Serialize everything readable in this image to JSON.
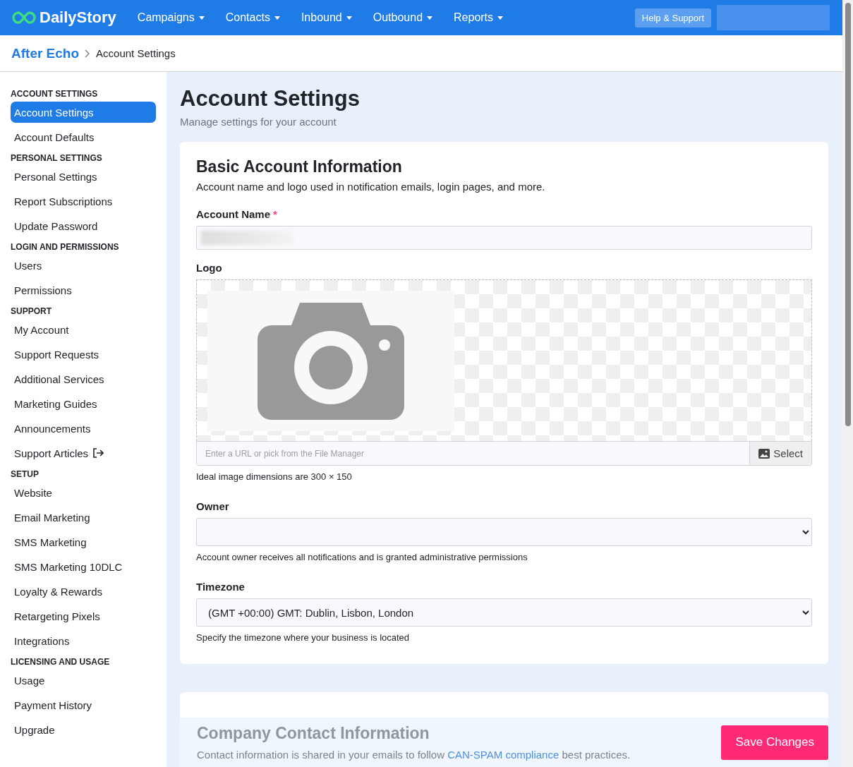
{
  "navbar": {
    "brand": "DailyStory",
    "menus": [
      {
        "label": "Campaigns"
      },
      {
        "label": "Contacts"
      },
      {
        "label": "Inbound"
      },
      {
        "label": "Outbound"
      },
      {
        "label": "Reports"
      }
    ],
    "help_button": "Help & Support"
  },
  "breadcrumb": {
    "items": [
      "After Echo",
      "Account Settings"
    ]
  },
  "sidebar": {
    "sections": [
      {
        "heading": "ACCOUNT SETTINGS",
        "items": [
          {
            "label": "Account Settings",
            "selected": true,
            "external": false
          },
          {
            "label": "Account Defaults",
            "selected": false,
            "external": false
          }
        ]
      },
      {
        "heading": "PERSONAL SETTINGS",
        "items": [
          {
            "label": "Personal Settings",
            "selected": false,
            "external": false
          },
          {
            "label": "Report Subscriptions",
            "selected": false,
            "external": false
          },
          {
            "label": "Update Password",
            "selected": false,
            "external": false
          }
        ]
      },
      {
        "heading": "LOGIN AND PERMISSIONS",
        "items": [
          {
            "label": "Users",
            "selected": false,
            "external": false
          },
          {
            "label": "Permissions",
            "selected": false,
            "external": false
          }
        ]
      },
      {
        "heading": "SUPPORT",
        "items": [
          {
            "label": "My Account",
            "selected": false,
            "external": false
          },
          {
            "label": "Support Requests",
            "selected": false,
            "external": false
          },
          {
            "label": "Additional Services",
            "selected": false,
            "external": false
          },
          {
            "label": "Marketing Guides",
            "selected": false,
            "external": false
          },
          {
            "label": "Announcements",
            "selected": false,
            "external": false
          },
          {
            "label": "Support Articles",
            "selected": false,
            "external": true
          }
        ]
      },
      {
        "heading": "SETUP",
        "items": [
          {
            "label": "Website",
            "selected": false,
            "external": false
          },
          {
            "label": "Email Marketing",
            "selected": false,
            "external": false
          },
          {
            "label": "SMS Marketing",
            "selected": false,
            "external": false
          },
          {
            "label": "SMS Marketing 10DLC",
            "selected": false,
            "external": false
          },
          {
            "label": "Loyalty & Rewards",
            "selected": false,
            "external": false
          },
          {
            "label": "Retargeting Pixels",
            "selected": false,
            "external": false
          },
          {
            "label": "Integrations",
            "selected": false,
            "external": false
          }
        ]
      },
      {
        "heading": "LICENSING AND USAGE",
        "items": [
          {
            "label": "Usage",
            "selected": false,
            "external": false
          },
          {
            "label": "Payment History",
            "selected": false,
            "external": false
          },
          {
            "label": "Upgrade",
            "selected": false,
            "external": false
          }
        ]
      }
    ]
  },
  "page": {
    "title": "Account Settings",
    "subtitle": "Manage settings for your account"
  },
  "basic_info": {
    "title": "Basic Account Information",
    "description": "Account name and logo used in notification emails, login pages, and more.",
    "account_name": {
      "label": "Account Name",
      "required": true,
      "required_mark": "*"
    },
    "logo": {
      "label": "Logo",
      "placeholder": "Enter a URL or pick from the File Manager",
      "select_button": "Select",
      "hint": "Ideal image dimensions are 300 × 150"
    },
    "owner": {
      "label": "Owner",
      "hint": "Account owner receives all notifications and is granted administrative permissions"
    },
    "timezone": {
      "label": "Timezone",
      "value": "(GMT +00:00) GMT: Dublin, Lisbon, London",
      "hint": "Specify the timezone where your business is located"
    }
  },
  "contact_info": {
    "title": "Company Contact Information",
    "description_before": "Contact information is shared in your emails to follow ",
    "link": "CAN-SPAM compliance",
    "description_after": " best practices."
  },
  "footer": {
    "save_button": "Save Changes"
  }
}
